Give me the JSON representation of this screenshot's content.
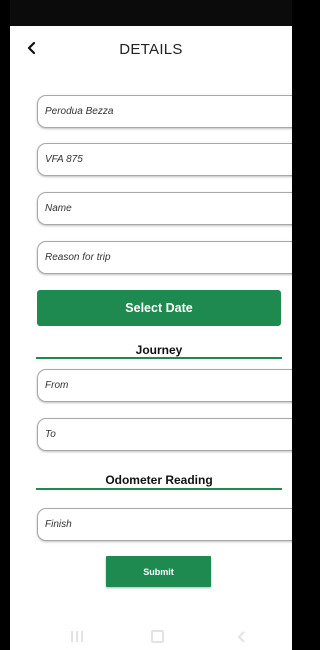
{
  "header": {
    "back_icon": "chevron-left-icon",
    "title": "DETAILS"
  },
  "form": {
    "vehicle_model": "Perodua Bezza",
    "plate_number": "VFA 875",
    "name_placeholder": "Name",
    "reason_placeholder": "Reason for trip",
    "select_date_label": "Select Date",
    "journey_heading": "Journey",
    "from_placeholder": "From",
    "to_placeholder": "To",
    "odometer_heading": "Odometer Reading",
    "finish_placeholder": "Finish",
    "submit_label": "Submit"
  },
  "navbar": {
    "recent_icon": "recent-apps-icon",
    "home_icon": "home-icon",
    "back_icon": "back-icon"
  },
  "colors": {
    "accent": "#1f8a50",
    "status_bar": "#0b0b0b"
  }
}
